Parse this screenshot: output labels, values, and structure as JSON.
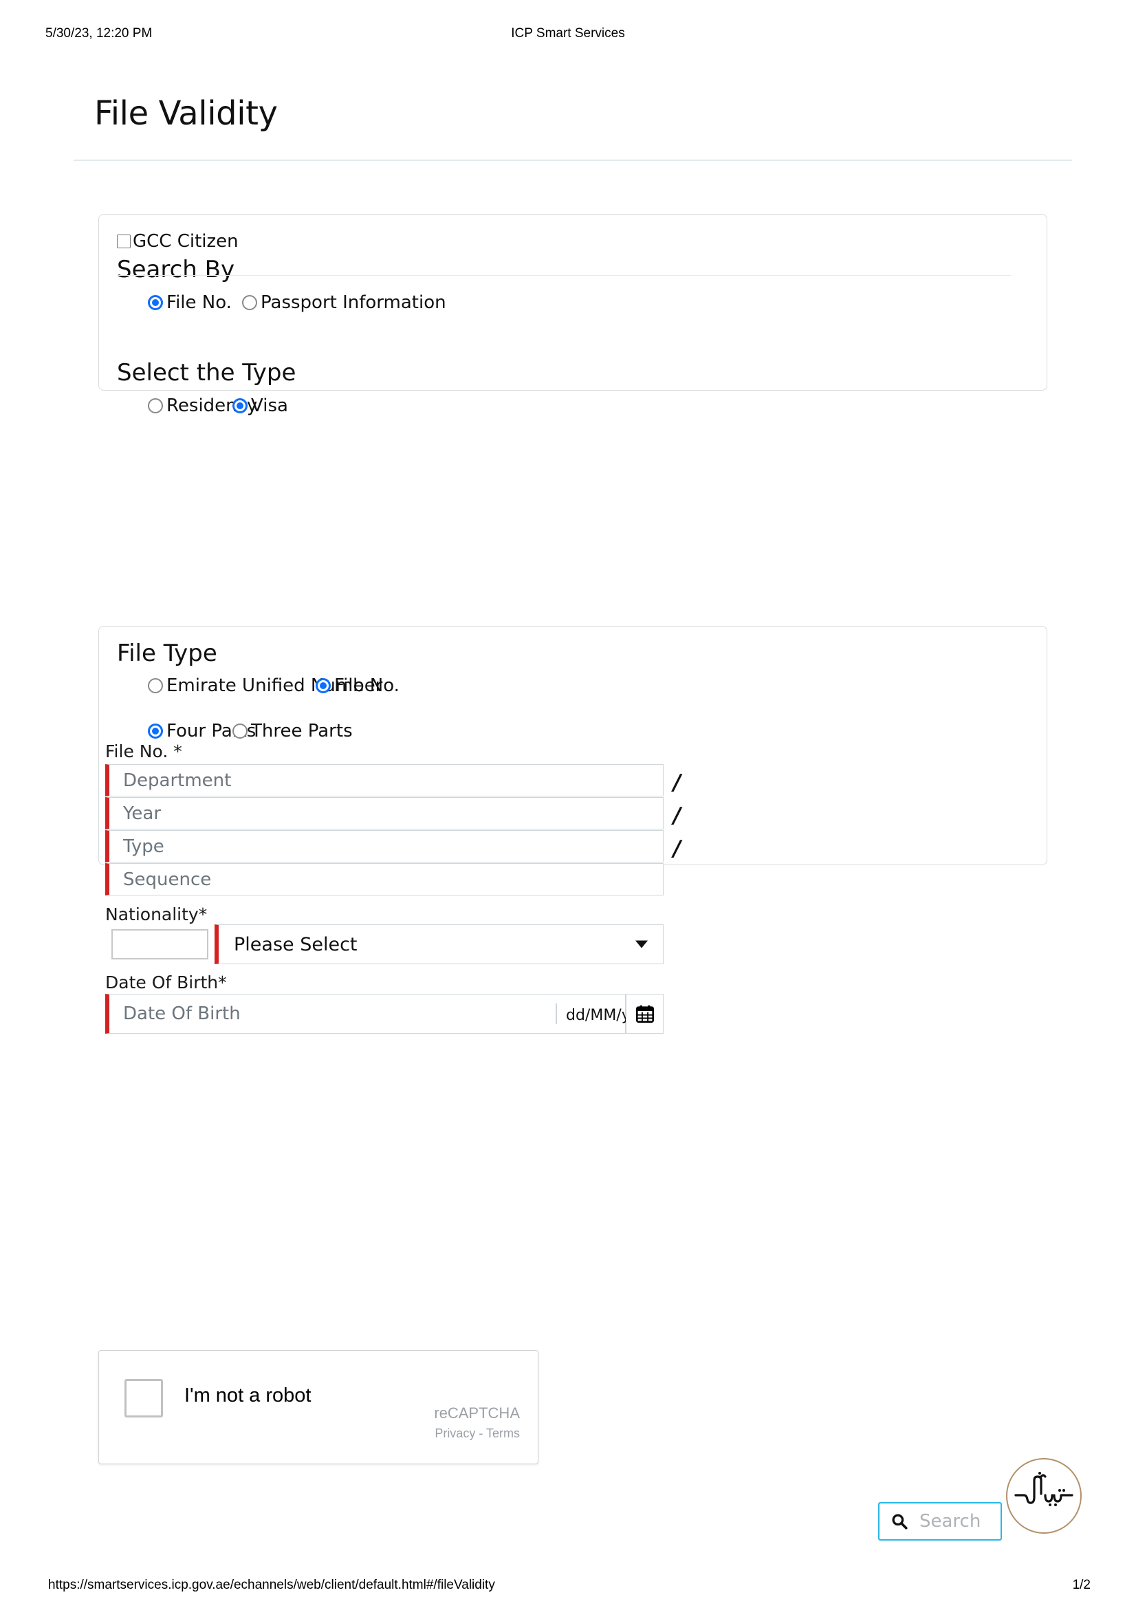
{
  "print": {
    "date": "5/30/23, 12:20 PM",
    "site_title": "ICP Smart Services",
    "url": "https://smartservices.icp.gov.ae/echannels/web/client/default.html#/fileValidity",
    "page_number": "1/2"
  },
  "page": {
    "title": "File Validity"
  },
  "colors": {
    "required_bar": "#d32222",
    "radio_selected": "#0d6efd",
    "search_border": "#29b6e8",
    "logo_ring": "#b2916a"
  },
  "search_card": {
    "gcc_checkbox": {
      "label": "GCC Citizen",
      "checked": false
    },
    "search_by": {
      "heading": "Search By",
      "options": [
        {
          "label": "File No.",
          "selected": true
        },
        {
          "label": "Passport Information",
          "selected": false
        }
      ]
    },
    "select_type": {
      "heading": "Select the Type",
      "options": [
        {
          "label": "Residency",
          "selected": false
        },
        {
          "label": "Visa",
          "selected": true
        }
      ]
    }
  },
  "file_type_card": {
    "heading": "File Type",
    "number_type_options": [
      {
        "label": "Emirate Unified Number",
        "selected": false
      },
      {
        "label": "File No.",
        "selected": true
      }
    ],
    "parts_options": [
      {
        "label": "Four Parts",
        "selected": true
      },
      {
        "label": "Three Parts",
        "selected": false
      }
    ],
    "file_no": {
      "label": "File No. *",
      "separator": "/",
      "fields": [
        {
          "placeholder": "Department",
          "value": ""
        },
        {
          "placeholder": "Year",
          "value": ""
        },
        {
          "placeholder": "Type",
          "value": ""
        },
        {
          "placeholder": "Sequence",
          "value": ""
        }
      ]
    },
    "nationality": {
      "label": "Nationality*",
      "flag_value": "",
      "select_value": "Please Select",
      "caret_icon": "chevron-down-icon"
    },
    "date_of_birth": {
      "label": "Date Of Birth*",
      "placeholder": "Date Of Birth",
      "value": "",
      "format_hint": "dd/MM/yyyy",
      "calendar_icon": "calendar-icon"
    }
  },
  "recaptcha": {
    "label": "I'm not a robot",
    "brand": "reCAPTCHA",
    "legal": "Privacy - Terms",
    "checked": false
  },
  "search_button": {
    "label": "Search",
    "icon": "search-icon"
  },
  "logo": {
    "name": "icp-calligraphy-logo"
  }
}
